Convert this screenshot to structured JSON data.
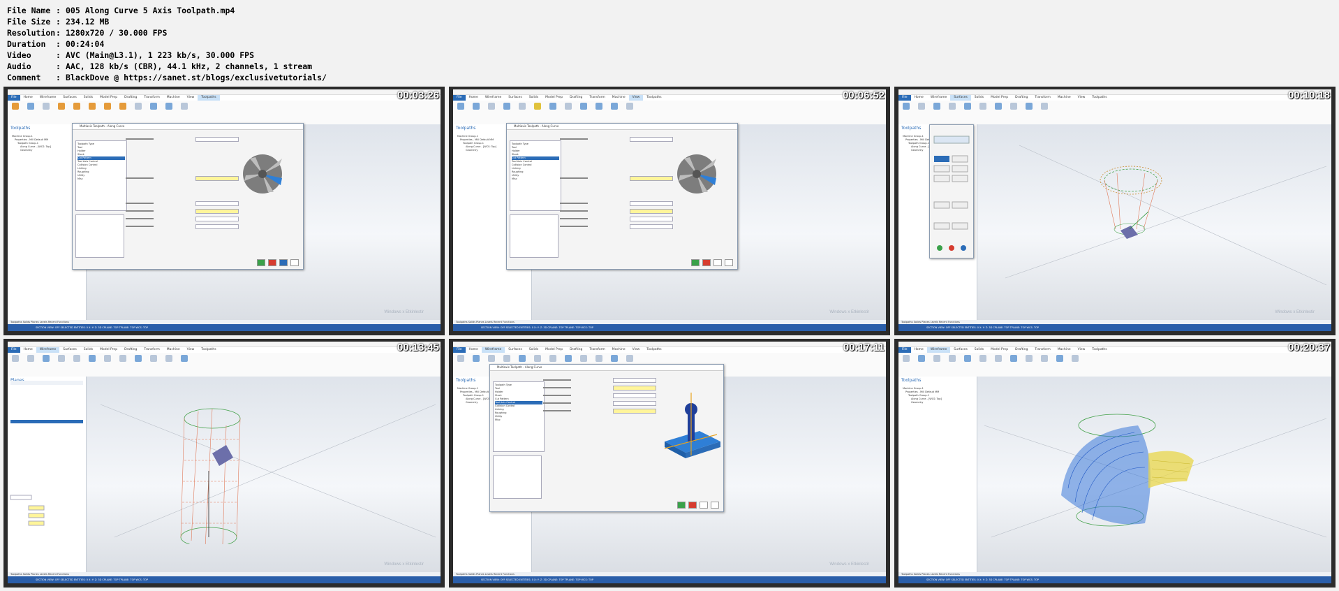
{
  "meta": [
    {
      "key": "File Name",
      "val": "005 Along Curve 5 Axis Toolpath.mp4"
    },
    {
      "key": "File Size",
      "val": "234.12 MB"
    },
    {
      "key": "Resolution",
      "val": "1280x720 / 30.000 FPS"
    },
    {
      "key": "Duration",
      "val": "00:24:04"
    },
    {
      "key": "Video",
      "val": "AVC (Main@L3.1), 1 223 kb/s, 30.000 FPS"
    },
    {
      "key": "Audio",
      "val": "AAC, 128 kb/s (CBR), 44.1 kHz, 2 channels, 1 stream"
    },
    {
      "key": "Comment",
      "val": "BlackDove @ https://sanet.st/blogs/exclusivetutorials/"
    }
  ],
  "separator": ":",
  "tiles": [
    {
      "timestamp": "00:03:26",
      "panel": "Toolpaths",
      "dialog": "Multiaxis Toolpath - Along Curve",
      "watermark": "Windows x Etkinlestir"
    },
    {
      "timestamp": "00:06:52",
      "panel": "Toolpaths",
      "dialog": "Multiaxis Toolpath - Along Curve",
      "watermark": "Windows x Etkinlestir"
    },
    {
      "timestamp": "00:10:18",
      "panel": "Toolpaths",
      "dialog": "",
      "watermark": "Windows x Etkinlestir"
    },
    {
      "timestamp": "00:13:45",
      "panel": "Planes",
      "dialog": "",
      "watermark": "Windows x Etkinlestir"
    },
    {
      "timestamp": "00:17:11",
      "panel": "Toolpaths",
      "dialog": "Multiaxis Toolpath - Along Curve",
      "watermark": "Windows x Etkinlestir"
    },
    {
      "timestamp": "00:20:37",
      "panel": "Toolpaths",
      "dialog": "",
      "watermark": ""
    }
  ],
  "menu": {
    "file": "File",
    "home": "Home",
    "wireframe": "Wireframe",
    "surfaces": "Surfaces",
    "solids": "Solids",
    "model_prep": "Model Prep",
    "drafting": "Drafting",
    "transform": "Transform",
    "machine": "Machine",
    "view": "View",
    "toolpaths": "Toolpaths"
  },
  "tree": [
    "Machine Group-1",
    "Properties - Mill Default MM",
    "Toolpath Group-1",
    "Along Curve - [WCS: Top]",
    "Geometry"
  ],
  "dialog_tree": [
    "Toolpath Type",
    "Tool",
    "Holder",
    "Stock",
    "Cut Pattern",
    "Tool Axis Control",
    "Collision Control",
    "Linking",
    "Roughing",
    "Utility",
    "Misc"
  ],
  "status": "SECTION VIEW: OFF    SELECTED ENTITIES: 0    X:    Y:    Z:    3D    CPLANE: TOP    TPLANE: TOP    WCS: TOP",
  "bottom_tabs": "Toolpaths   Solids   Planes   Levels   Recent Functions"
}
